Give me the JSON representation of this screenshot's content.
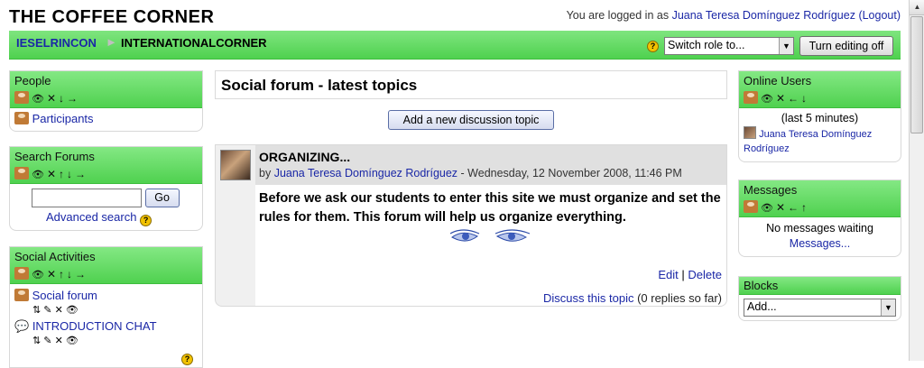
{
  "header": {
    "site_title": "THE COFFEE CORNER",
    "login_prefix": "You are logged in as",
    "user_name": "Juana Teresa Domínguez Rodríguez",
    "logout_label": "(Logout)"
  },
  "navbar": {
    "breadcrumb_home": "IESELRINCON",
    "breadcrumb_separator": "►",
    "breadcrumb_current": "INTERNATIONALCORNER",
    "role_select_value": "Switch role to...",
    "edit_button": "Turn editing off"
  },
  "left_blocks": {
    "people": {
      "title": "People",
      "link": "Participants"
    },
    "search": {
      "title": "Search Forums",
      "input_value": "",
      "go_label": "Go",
      "advanced_label": "Advanced search"
    },
    "activities": {
      "title": "Social Activities",
      "items": [
        {
          "label": "Social forum",
          "icon": "people-icon"
        },
        {
          "label": "INTRODUCTION CHAT",
          "icon": "chat-icon"
        }
      ]
    }
  },
  "main": {
    "heading": "Social forum - latest topics",
    "add_topic_button": "Add a new discussion topic",
    "post": {
      "subject": "ORGANIZING...",
      "by_prefix": "by",
      "author": "Juana Teresa Domínguez Rodríguez",
      "date": " - Wednesday, 12 November 2008, 11:46 PM",
      "message": "Before we ask our students to enter this site we must organize and set the rules for them. This forum will help us organize everything.",
      "edit_label": "Edit",
      "separator": "|",
      "delete_label": "Delete",
      "discuss_label": "Discuss this topic",
      "replies_text": "(0 replies so far)"
    }
  },
  "right_blocks": {
    "online": {
      "title": "Online Users",
      "period": "(last 5 minutes)",
      "user": "Juana Teresa Domínguez Rodríguez"
    },
    "messages": {
      "title": "Messages",
      "status": "No messages waiting",
      "link": "Messages..."
    },
    "blocks": {
      "title": "Blocks",
      "select_value": "Add..."
    }
  },
  "colors": {
    "header_green": "#4fd14f",
    "link_blue": "#1a27a6"
  }
}
